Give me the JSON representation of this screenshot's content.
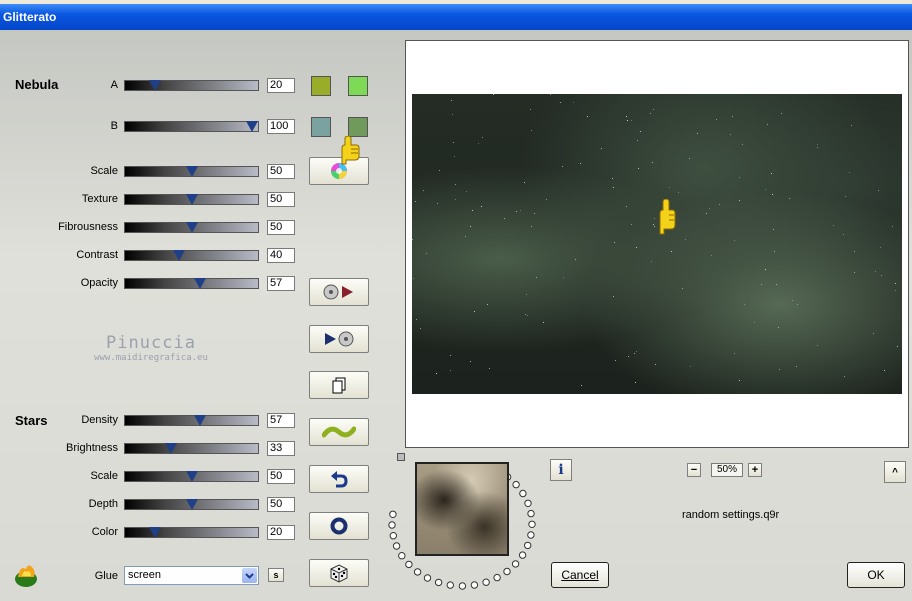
{
  "window": {
    "title": "Glitterato"
  },
  "nebula": {
    "section_label": "Nebula",
    "sliders": [
      {
        "label": "A",
        "value": "20",
        "fraction": 0.2
      },
      {
        "label": "B",
        "value": "100",
        "fraction": 1.0
      },
      {
        "label": "Scale",
        "value": "50",
        "fraction": 0.5
      },
      {
        "label": "Texture",
        "value": "50",
        "fraction": 0.5
      },
      {
        "label": "Fibrousness",
        "value": "50",
        "fraction": 0.5
      },
      {
        "label": "Contrast",
        "value": "40",
        "fraction": 0.4
      },
      {
        "label": "Opacity",
        "value": "57",
        "fraction": 0.57
      }
    ],
    "colors": {
      "a1": "#9aad2a",
      "a2": "#7ed957",
      "b1": "#7aa3a0",
      "b2": "#6f9a5c"
    }
  },
  "stars": {
    "section_label": "Stars",
    "sliders": [
      {
        "label": "Density",
        "value": "57",
        "fraction": 0.57
      },
      {
        "label": "Brightness",
        "value": "33",
        "fraction": 0.33
      },
      {
        "label": "Scale",
        "value": "50",
        "fraction": 0.5
      },
      {
        "label": "Depth",
        "value": "50",
        "fraction": 0.5
      },
      {
        "label": "Color",
        "value": "20",
        "fraction": 0.2
      }
    ]
  },
  "glue": {
    "label": "Glue",
    "selected": "screen",
    "s_button": "s"
  },
  "watermark": {
    "line1": "Pinuccia",
    "line2": "www.maidiregrafica.eu"
  },
  "preview": {
    "zoom": "50%",
    "zoom_minus": "−",
    "zoom_plus": "+",
    "info": "i",
    "collapse": "^",
    "settings_file": "random settings.q9r"
  },
  "buttons": {
    "cancel": "Cancel",
    "ok": "OK"
  },
  "icons": [
    "color-wheel-icon",
    "play-reverse-icon",
    "play-forward-icon",
    "copy-icon",
    "wave-icon",
    "undo-icon",
    "ring-icon",
    "dice-icon",
    "flame-logo-icon",
    "pointing-hand-icon"
  ]
}
